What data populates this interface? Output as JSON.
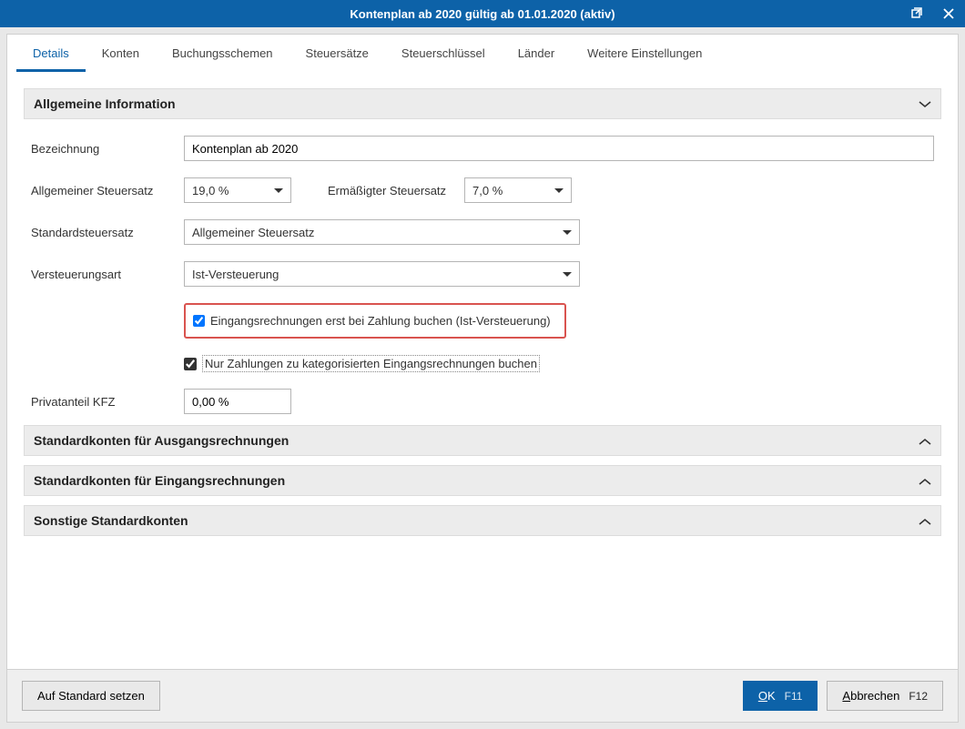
{
  "title": "Kontenplan ab 2020 gültig ab 01.01.2020 (aktiv)",
  "tabs": {
    "details": "Details",
    "konten": "Konten",
    "buchungsschemen": "Buchungsschemen",
    "steuersaetze": "Steuersätze",
    "steuerschluessel": "Steuerschlüssel",
    "laender": "Länder",
    "weitere": "Weitere Einstellungen"
  },
  "sections": {
    "general": {
      "title": "Allgemeine Information",
      "labels": {
        "bezeichnung": "Bezeichnung",
        "allg_steuersatz": "Allgemeiner Steuersatz",
        "erm_steuersatz": "Ermäßigter Steuersatz",
        "std_steuersatz": "Standardsteuersatz",
        "versteuerungsart": "Versteuerungsart",
        "privatanteil": "Privatanteil KFZ"
      },
      "values": {
        "bezeichnung": "Kontenplan ab 2020",
        "allg_steuersatz": "19,0 %",
        "erm_steuersatz": "7,0 %",
        "std_steuersatz": "Allgemeiner Steuersatz",
        "versteuerungsart": "Ist-Versteuerung",
        "privatanteil": "0,00 %"
      },
      "checkbox1": "Eingangsrechnungen erst bei Zahlung buchen (Ist-Versteuerung)",
      "checkbox2": "Nur Zahlungen zu kategorisierten Eingangsrechnungen buchen"
    },
    "ausgang": {
      "title": "Standardkonten für Ausgangsrechnungen"
    },
    "eingang": {
      "title": "Standardkonten für Eingangsrechnungen"
    },
    "sonstige": {
      "title": "Sonstige Standardkonten"
    }
  },
  "footer": {
    "reset": "Auf Standard setzen",
    "ok": "OK",
    "ok_mnemonic": "O",
    "ok_rest": "K",
    "ok_shortcut": "F11",
    "cancel_mnemonic": "A",
    "cancel_rest": "bbrechen",
    "cancel_shortcut": "F12"
  }
}
